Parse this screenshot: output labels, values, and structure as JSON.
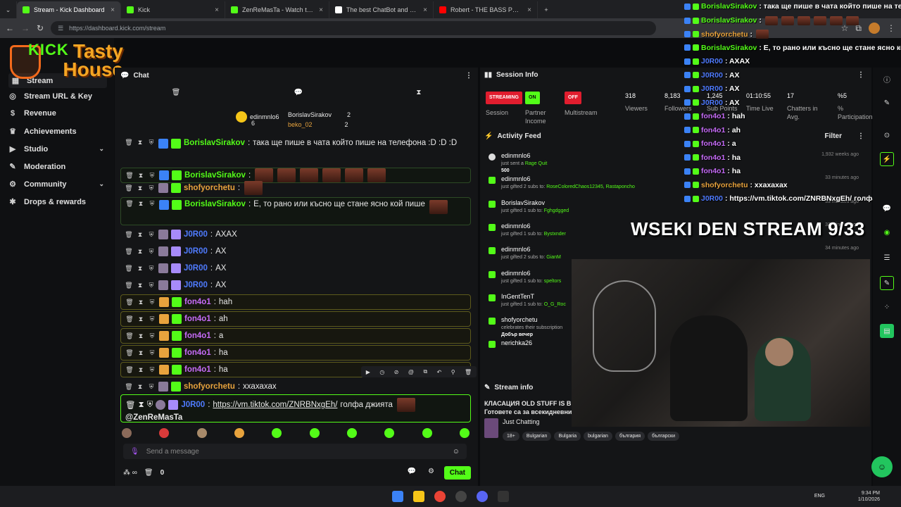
{
  "browser": {
    "tabs": [
      {
        "title": "Stream - Kick Dashboard",
        "color": "#53fc18",
        "active": true
      },
      {
        "title": "Kick",
        "color": "#53fc18",
        "active": false
      },
      {
        "title": "ZenReMasTa - Watch the VOD",
        "color": "#53fc18",
        "active": false
      },
      {
        "title": "The best ChatBot and Widgets",
        "color": "#ffffff",
        "active": false
      },
      {
        "title": "Robert - THE BASS PROTOCOL",
        "color": "#ff0000",
        "active": false
      }
    ],
    "url": "https://dashboard.kick.com/stream"
  },
  "logo": {
    "kick": "KICK",
    "tasty": "Tasty",
    "house": "House"
  },
  "sidebar": {
    "items": [
      {
        "label": "Stream",
        "icon": "dashboard-icon"
      },
      {
        "label": "Stream URL & Key",
        "icon": "globe-icon"
      },
      {
        "label": "Revenue",
        "icon": "money-icon"
      },
      {
        "label": "Achievements",
        "icon": "trophy-icon"
      },
      {
        "label": "Studio",
        "icon": "video-icon",
        "expandable": true
      },
      {
        "label": "Moderation",
        "icon": "wrench-icon"
      },
      {
        "label": "Community",
        "icon": "gear-icon",
        "expandable": true
      },
      {
        "label": "Drops & rewards",
        "icon": "gift-icon"
      }
    ]
  },
  "chat": {
    "title": "Chat",
    "pinned": {
      "top_name": "edinmnlo6",
      "top_count": "6",
      "user1": "BorislavSirakov",
      "user1_count": "2",
      "user2": "beko_02",
      "user2_count": "2"
    },
    "messages": [
      {
        "user": "BorislavSirakov",
        "color": "#53fc18",
        "text": "така ще пише в чата който пише на телефона :D :D :D",
        "style": "plain"
      },
      {
        "user": "BorislavSirakov",
        "color": "#53fc18",
        "text": "",
        "emotes": 6,
        "style": "hlg"
      },
      {
        "user": "shofyorchetu",
        "color": "#e8a33d",
        "text": "",
        "emotes": 1,
        "style": "plain"
      },
      {
        "user": "BorislavSirakov",
        "color": "#53fc18",
        "text": "Е, то рано или късно ще стане ясно кой пише",
        "emotes": 1,
        "style": "hlg"
      },
      {
        "user": "J0R00",
        "color": "#4f7bff",
        "text": "AXAX",
        "style": "plain"
      },
      {
        "user": "J0R00",
        "color": "#4f7bff",
        "text": "AX",
        "style": "plain"
      },
      {
        "user": "J0R00",
        "color": "#4f7bff",
        "text": "AX",
        "style": "plain"
      },
      {
        "user": "J0R00",
        "color": "#4f7bff",
        "text": "AX",
        "style": "plain"
      },
      {
        "user": "fon4o1",
        "color": "#c56bf7",
        "text": "hah",
        "style": "hl"
      },
      {
        "user": "fon4o1",
        "color": "#c56bf7",
        "text": "ah",
        "style": "hl"
      },
      {
        "user": "fon4o1",
        "color": "#c56bf7",
        "text": "a",
        "style": "hl"
      },
      {
        "user": "fon4o1",
        "color": "#c56bf7",
        "text": "ha",
        "style": "hl"
      },
      {
        "user": "fon4o1",
        "color": "#c56bf7",
        "text": "ha",
        "style": "hl"
      },
      {
        "user": "shofyorchetu",
        "color": "#e8a33d",
        "text": "ххахахах",
        "style": "plain"
      }
    ],
    "last_message": {
      "user": "J0R00",
      "link": "https://vm.tiktok.com/ZNRBNxgEh/",
      "text": "голфа джията",
      "mention": "@ZenReMasTa"
    },
    "input_placeholder": "Send a message",
    "bottom_count": "0",
    "chat_button": "Chat"
  },
  "session": {
    "title": "Session Info",
    "statuses": [
      {
        "pill": "STREAMING",
        "label": "Session",
        "color": "#e11d2e"
      },
      {
        "pill": "ON",
        "label": "Partner Income",
        "color": "#53fc18"
      },
      {
        "pill": "OFF",
        "label": "Multistream",
        "color": "#e11d2e"
      }
    ],
    "stats": [
      {
        "value": "318",
        "label": "Viewers"
      },
      {
        "value": "8,183",
        "label": "Followers"
      },
      {
        "value": "1,245",
        "label": "Sub Points"
      },
      {
        "value": "01:10:55",
        "label": "Time Live"
      },
      {
        "value": "17",
        "label": "Chatters in Avg."
      },
      {
        "value": "%5",
        "label": "% Participation"
      }
    ]
  },
  "activity": {
    "title": "Activity Feed",
    "filter": "Filter",
    "items": [
      {
        "name": "edinmnlo6",
        "desc": "just sent a ",
        "hl": "Rage Quit",
        "extra": "500",
        "time": "1,932 weeks ago"
      },
      {
        "name": "edinmnlo6",
        "desc": "just gifted 2 subs to: ",
        "hl": "RoseColoredChaos12345, Rastaponcho",
        "time": "33 minutes ago"
      },
      {
        "name": "BorislavSirakov",
        "desc": "just gifted 1 sub to: ",
        "hl": "Fghgdgged",
        "time": "33 minutes ago"
      },
      {
        "name": "edinmnlo6",
        "desc": "just gifted 1 sub to: ",
        "hl": "Bystxnder",
        "time": "33 minutes ago"
      },
      {
        "name": "edinmnlo6",
        "desc": "just gifted 2 subs to: ",
        "hl": "GianM",
        "time": "34 minutes ago"
      },
      {
        "name": "edinmnlo6",
        "desc": "just gifted 1 sub to: ",
        "hl": "speltors",
        "time": ""
      },
      {
        "name": "InGentTenT",
        "desc": "just gifted 1 sub to: ",
        "hl": "O_G_Roc",
        "time": ""
      },
      {
        "name": "shofyorchetu",
        "desc": "celebrates their subscription",
        "hl": "",
        "extra": "Добър вечер",
        "time": ""
      },
      {
        "name": "nerichka26",
        "desc": "",
        "hl": "",
        "time": ""
      }
    ]
  },
  "stream_info": {
    "title": "Stream info",
    "stream_title_1": "КЛАСАЦИЯ OLD STUFF IS B",
    "stream_title_2": "Готовете са за всекидневни",
    "category": "Just Chatting",
    "tags": [
      "18+",
      "Bulgarian",
      "Bulgaria",
      "bulgarian",
      "българия",
      "български"
    ]
  },
  "overlay": {
    "lines": [
      {
        "user": "BorislavSirakov",
        "color": "#53fc18",
        "text": ": така ще пише в чата който пише на те"
      },
      {
        "user": "BorislavSirakov",
        "color": "#53fc18",
        "text": ":"
      },
      {
        "user": "shofyorchetu",
        "color": "#e8a33d",
        "text": ":"
      },
      {
        "user": "BorislavSirakov",
        "color": "#53fc18",
        "text": ": Е, то рано или късно ще стане ясно ко"
      },
      {
        "user": "J0R00",
        "color": "#4f7bff",
        "text": ": AXAX"
      },
      {
        "user": "J0R00",
        "color": "#4f7bff",
        "text": ": AX"
      },
      {
        "user": "J0R00",
        "color": "#4f7bff",
        "text": ": AX"
      },
      {
        "user": "J0R00",
        "color": "#4f7bff",
        "text": ": AX"
      },
      {
        "user": "fon4o1",
        "color": "#c56bf7",
        "text": ": hah"
      },
      {
        "user": "fon4o1",
        "color": "#c56bf7",
        "text": ": ah"
      },
      {
        "user": "fon4o1",
        "color": "#c56bf7",
        "text": ": a"
      },
      {
        "user": "fon4o1",
        "color": "#c56bf7",
        "text": ": ha"
      },
      {
        "user": "fon4o1",
        "color": "#c56bf7",
        "text": ": ha"
      },
      {
        "user": "shofyorchetu",
        "color": "#e8a33d",
        "text": ": ххахахах"
      },
      {
        "user": "J0R00",
        "color": "#4f7bff",
        "text": ": https://vm.tiktok.com/ZNRBNxgEh/ голфа джията"
      }
    ],
    "stream_title": "WSEKI DEN STREAM 9/33"
  },
  "taskbar": {
    "time": "9:34 PM",
    "date": "1/10/2026",
    "lang": "ENG"
  }
}
